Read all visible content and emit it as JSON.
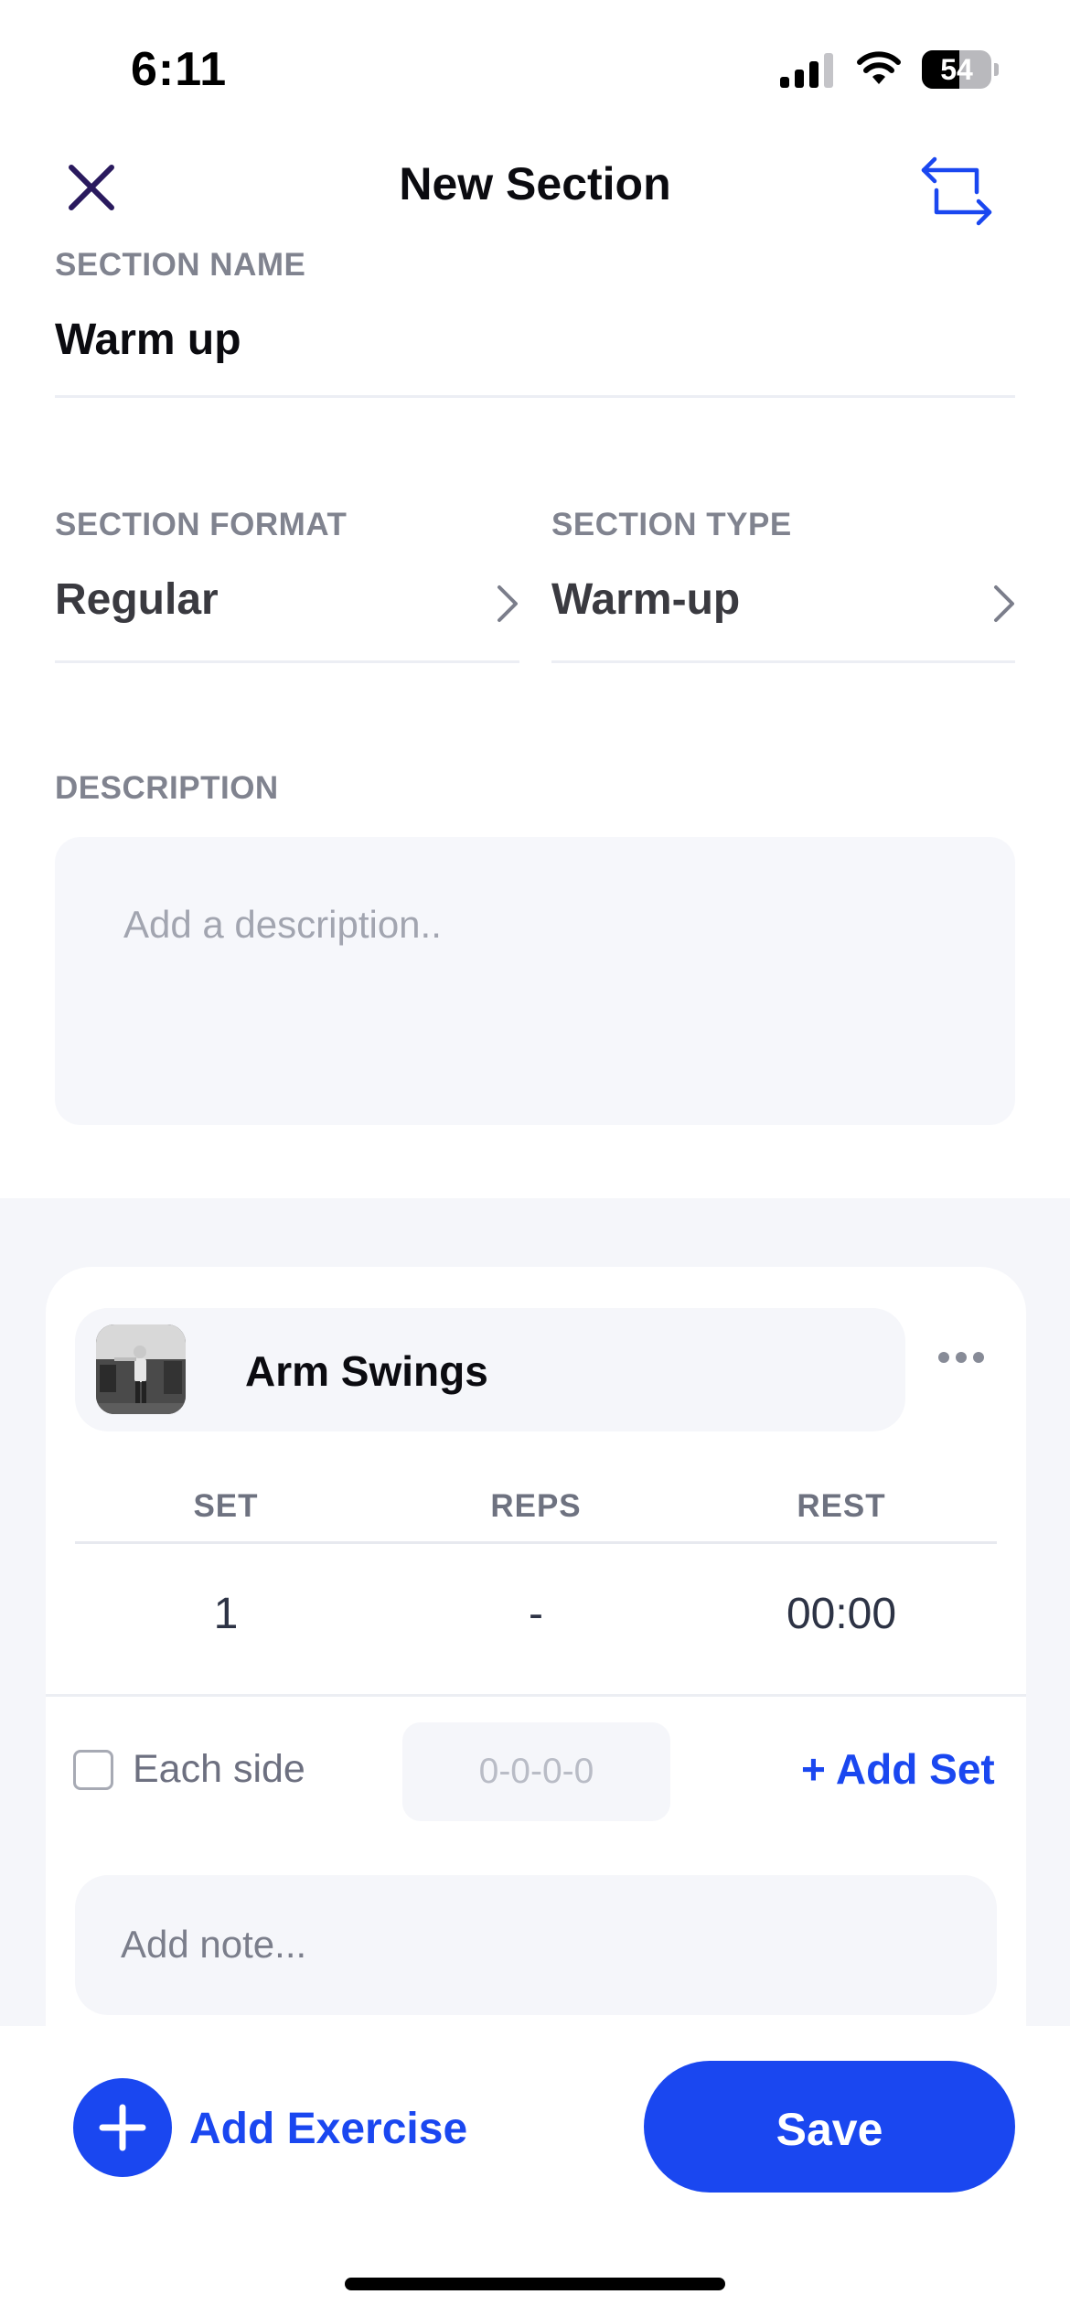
{
  "status_bar": {
    "time": "6:11",
    "battery": "54",
    "battery_level": 0.54
  },
  "header": {
    "title": "New Section"
  },
  "form": {
    "section_name_label": "SECTION NAME",
    "section_name_value": "Warm up",
    "section_format_label": "SECTION FORMAT",
    "section_format_value": "Regular",
    "section_type_label": "SECTION TYPE",
    "section_type_value": "Warm-up",
    "description_label": "DESCRIPTION",
    "description_placeholder": "Add a description.."
  },
  "exercise": {
    "name": "Arm Swings",
    "columns": [
      "SET",
      "REPS",
      "REST"
    ],
    "rows": [
      {
        "set": "1",
        "reps": "-",
        "rest": "00:00"
      }
    ],
    "each_side_label": "Each side",
    "each_side_checked": false,
    "tempo_placeholder": "0-0-0-0",
    "add_set_label": "+ Add Set",
    "note_placeholder": "Add note..."
  },
  "bottom": {
    "add_exercise_label": "Add Exercise",
    "save_label": "Save"
  },
  "colors": {
    "accent": "#1a47f0",
    "label": "#80838f",
    "surface": "#f5f6fa"
  }
}
